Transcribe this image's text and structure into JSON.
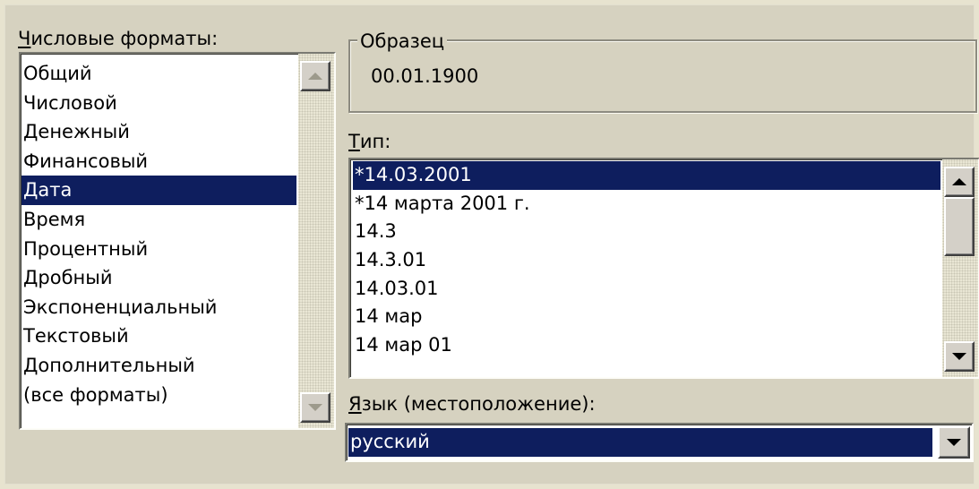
{
  "number_formats": {
    "label_accesskey": "Ч",
    "label_rest": "исловые форматы:",
    "items": [
      "Общий",
      "Числовой",
      "Денежный",
      "Финансовый",
      "Дата",
      "Время",
      "Процентный",
      "Дробный",
      "Экспоненциальный",
      "Текстовый",
      "Дополнительный",
      "(все форматы)"
    ],
    "selected": "Дата"
  },
  "sample": {
    "title": "Образец",
    "value": "00.01.1900"
  },
  "type": {
    "label_accesskey": "Т",
    "label_rest": "ип:",
    "items": [
      "*14.03.2001",
      "*14 марта 2001 г.",
      "14.3",
      "14.3.01",
      "14.03.01",
      "14 мар",
      "14 мар 01"
    ],
    "selected": "*14.03.2001"
  },
  "locale": {
    "label_accesskey": "Я",
    "label_rest": "зык (местоположение):",
    "value": "русский"
  },
  "icons": {
    "scroll_up": "scroll-up-arrow-icon",
    "scroll_down": "scroll-down-arrow-icon",
    "dropdown": "dropdown-arrow-icon"
  },
  "colors": {
    "selection": "#0e1e5e",
    "dialog": "#d6d2c0"
  }
}
